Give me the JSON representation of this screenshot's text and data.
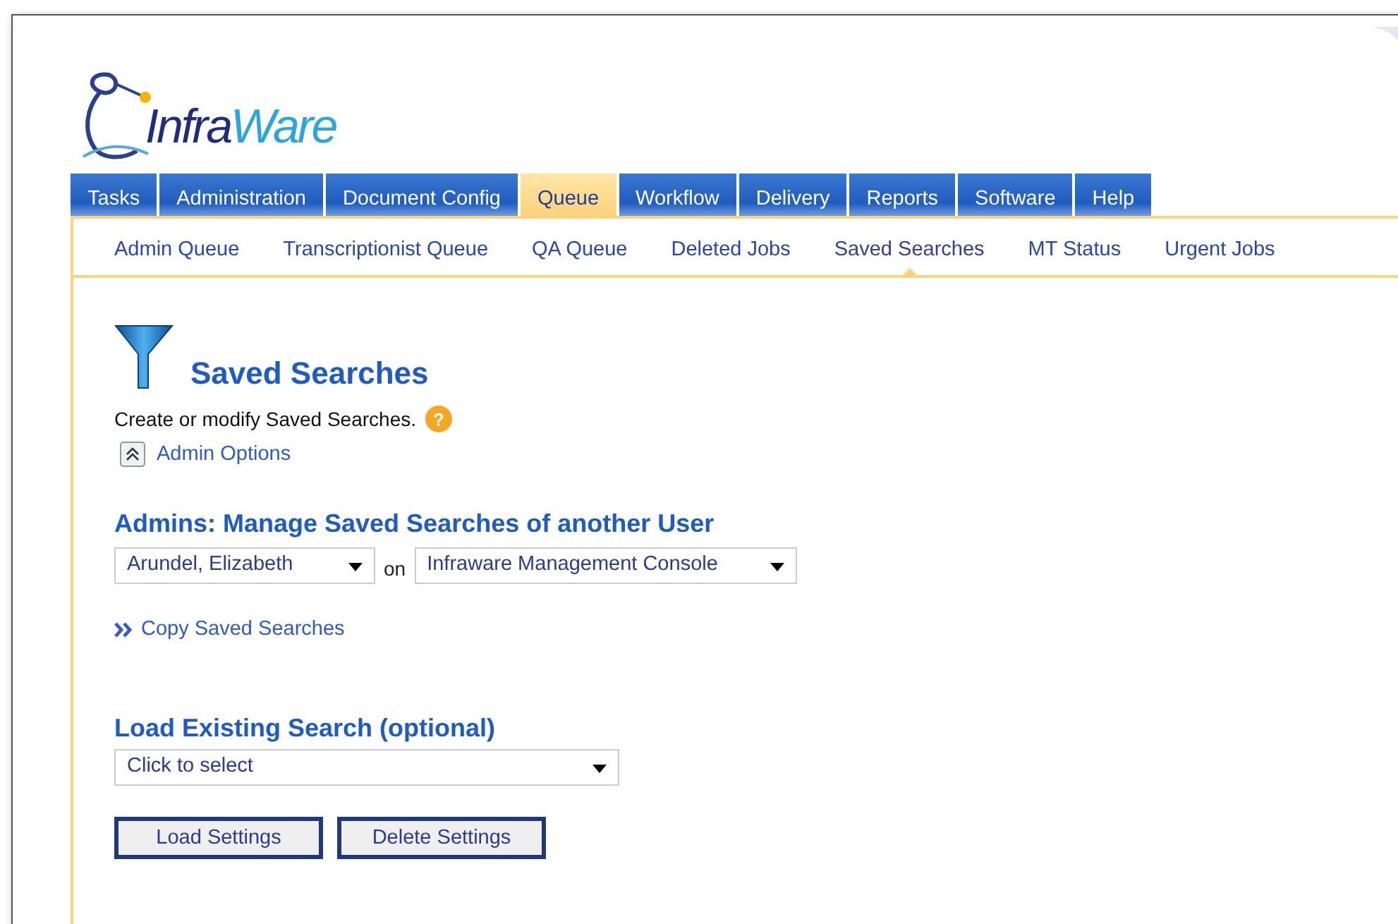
{
  "logo": {
    "part_1": "Infra",
    "part_2": "Ware"
  },
  "tabs": [
    {
      "label": "Tasks",
      "selected": false
    },
    {
      "label": "Administration",
      "selected": false
    },
    {
      "label": "Document Config",
      "selected": false
    },
    {
      "label": "Queue",
      "selected": true
    },
    {
      "label": "Workflow",
      "selected": false
    },
    {
      "label": "Delivery",
      "selected": false
    },
    {
      "label": "Reports",
      "selected": false
    },
    {
      "label": "Software",
      "selected": false
    },
    {
      "label": "Help",
      "selected": false
    }
  ],
  "subtabs": [
    {
      "label": "Admin Queue",
      "selected": false
    },
    {
      "label": "Transcriptionist Queue",
      "selected": false
    },
    {
      "label": "QA Queue",
      "selected": false
    },
    {
      "label": "Deleted Jobs",
      "selected": false
    },
    {
      "label": "Saved Searches",
      "selected": true
    },
    {
      "label": "MT Status",
      "selected": false
    },
    {
      "label": "Urgent Jobs",
      "selected": false
    }
  ],
  "page_title": "Saved Searches",
  "description": "Create or modify Saved Searches.",
  "help_icon": "?",
  "admin_options": {
    "label": "Admin Options",
    "expanded": true
  },
  "manage_section": {
    "heading": "Admins: Manage Saved Searches of another User",
    "user_select": "Arundel, Elizabeth",
    "connector": "on",
    "app_select": "Infraware Management Console",
    "copy_link": "Copy Saved Searches"
  },
  "load_section": {
    "heading": "Load Existing Search (optional)",
    "search_select": "Click to select",
    "buttons": [
      "Load Settings",
      "Delete Settings"
    ]
  }
}
